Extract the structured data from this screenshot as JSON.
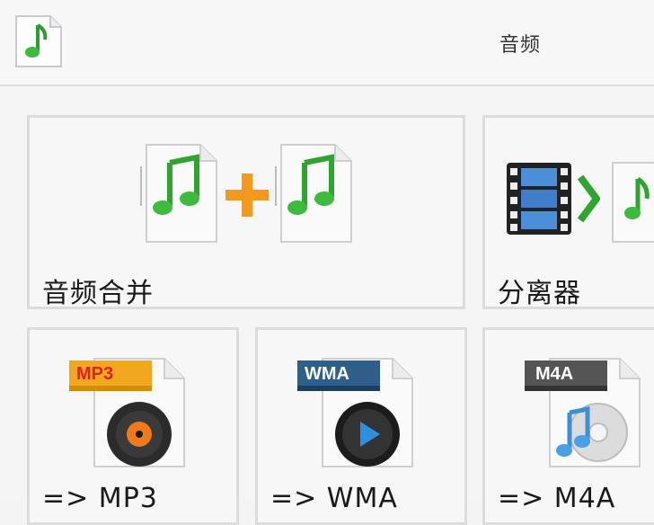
{
  "header": {
    "title": "音频",
    "app_icon": "music-note-icon"
  },
  "tiles": {
    "merge": {
      "label": "音频合并",
      "icons": [
        "music-file-icon",
        "plus-icon",
        "music-file-icon"
      ]
    },
    "separator": {
      "label": "分离器",
      "icons": [
        "film-strip-icon",
        "chevron-right-icon",
        "music-file-icon"
      ]
    },
    "to_mp3": {
      "label": "=> MP3",
      "badge": "MP3",
      "icon": "vinyl-disc-icon"
    },
    "to_wma": {
      "label": "=> WMA",
      "badge": "WMA",
      "icon": "play-disc-icon"
    },
    "to_m4a": {
      "label": "=> M4A",
      "badge": "M4A",
      "icon": "music-cd-icon"
    }
  },
  "colors": {
    "note_green": "#3dbb3d",
    "plus_orange": "#f39a1e",
    "mp3_badge": "#f0a81e",
    "wma_badge": "#2e5f8a",
    "m4a_badge": "#555555"
  }
}
